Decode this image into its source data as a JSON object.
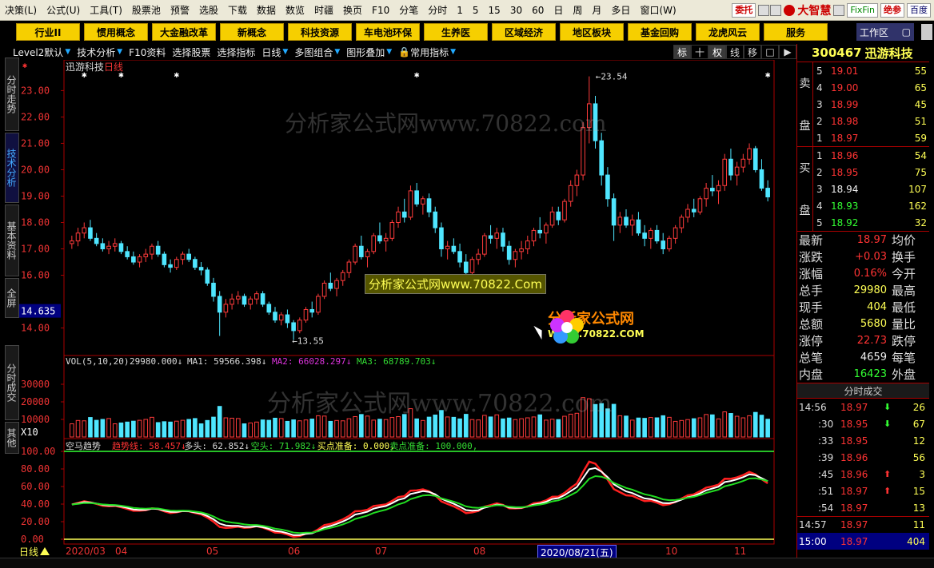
{
  "menu": {
    "items": [
      "决策(L)",
      "公式(U)",
      "工具(T)",
      "股票池",
      "预警",
      "选股",
      "下载",
      "数据",
      "数览",
      "时疆",
      "换页",
      "F10",
      "分笔",
      "分时",
      "1",
      "5",
      "15",
      "30",
      "60",
      "日",
      "周",
      "月",
      "多日",
      "窗口(W)"
    ],
    "badges": [
      "委托",
      "FixFin",
      "绝参",
      "百度"
    ],
    "brand": "大智慧"
  },
  "toolbar_buttons": [
    "行业II",
    "惯用概念",
    "大金融改革",
    "新概念",
    "科技资源",
    "车电池环保",
    "生养医",
    "区域经济",
    "地区板块",
    "基金回购",
    "龙虎风云",
    "服务"
  ],
  "workarea_label": "工作区",
  "left_tabs": [
    "分时走势",
    "技术分析",
    "基本资料",
    "全屏",
    "分时成交",
    "其他"
  ],
  "tool_row": {
    "items": [
      "Level2默认",
      "技术分析",
      "F10资料",
      "选择股票",
      "选择指标",
      "日线",
      "多图组合",
      "图形叠加",
      "常用指标"
    ],
    "toggles": [
      "标",
      "十",
      "权",
      "线",
      "移",
      "□",
      "▶"
    ]
  },
  "stock": {
    "code": "300467",
    "name": "迅游科技"
  },
  "chart": {
    "title": "迅游科技",
    "period_tag": "日线",
    "cursor_value": "14.635",
    "high_label": "23.54",
    "low_label": "13.55",
    "y_ticks": [
      "23.00",
      "22.00",
      "21.00",
      "20.00",
      "19.00",
      "18.00",
      "17.00",
      "16.00",
      "14.00"
    ],
    "vol_label": "VOL(5,10,20)",
    "vol_values": [
      {
        "name": "",
        "text": "29980.000↓",
        "color": "#dddddd"
      },
      {
        "name": "MA1:",
        "text": "59566.398↓",
        "color": "#dddddd"
      },
      {
        "name": "MA2:",
        "text": "66028.297↓",
        "color": "#dd33dd"
      },
      {
        "name": "MA3:",
        "text": "68789.703↓",
        "color": "#33dd33"
      }
    ],
    "vol_ticks": [
      "30000",
      "20000",
      "10000"
    ],
    "vol_unit": "X10",
    "ind_label": "空马趋势",
    "ind_values": [
      {
        "text": "趋势线: 58.457↓",
        "color": "#ff3333"
      },
      {
        "text": "多头: 62.852↓",
        "color": "#dddddd"
      },
      {
        "text": "空头: 71.982↓",
        "color": "#33dd33"
      },
      {
        "text": "买点准备: 0.000,",
        "color": "#ffff55"
      },
      {
        "text": "卖点准备: 100.000,",
        "color": "#33dd33"
      }
    ],
    "ind_ticks": [
      "100.00",
      "80.00",
      "60.00",
      "40.00",
      "20.00",
      "0.00"
    ],
    "months": [
      "2020/03",
      "04",
      "05",
      "06",
      "07",
      "08",
      "10",
      "11"
    ],
    "date_box": "2020/08/21(五)",
    "bottom_period": "日线"
  },
  "watermark": {
    "text1": "分析家公式网www.70822.com",
    "text2": "分析家公式网www.70822.com",
    "boxed": "分析家公式网www.70822.Com",
    "logo_a": "分析家公式网",
    "logo_b": "WWW.70822.COM"
  },
  "chart_data": {
    "type": "candlestick",
    "title": "迅游科技",
    "ylim": [
      13.2,
      23.8
    ],
    "candles": [
      [
        17.2,
        17.5,
        17.0,
        17.3
      ],
      [
        17.3,
        17.8,
        17.1,
        17.6
      ],
      [
        17.6,
        18.0,
        17.4,
        17.8
      ],
      [
        17.8,
        18.1,
        17.3,
        17.4
      ],
      [
        17.4,
        17.6,
        17.1,
        17.2
      ],
      [
        17.2,
        17.4,
        16.9,
        17.0
      ],
      [
        17.0,
        17.3,
        16.8,
        17.1
      ],
      [
        17.1,
        17.4,
        16.9,
        17.2
      ],
      [
        17.2,
        17.3,
        16.8,
        16.9
      ],
      [
        16.9,
        17.1,
        16.6,
        16.7
      ],
      [
        16.7,
        16.9,
        16.4,
        16.5
      ],
      [
        16.5,
        16.8,
        16.3,
        16.7
      ],
      [
        16.7,
        17.0,
        16.5,
        16.8
      ],
      [
        16.8,
        17.2,
        16.6,
        17.1
      ],
      [
        17.1,
        17.3,
        16.7,
        16.8
      ],
      [
        16.8,
        16.9,
        16.3,
        16.4
      ],
      [
        16.4,
        16.6,
        16.1,
        16.3
      ],
      [
        16.3,
        16.7,
        16.2,
        16.6
      ],
      [
        16.6,
        16.9,
        16.4,
        16.8
      ],
      [
        16.8,
        17.0,
        16.5,
        16.6
      ],
      [
        16.6,
        16.7,
        16.2,
        16.3
      ],
      [
        16.3,
        16.5,
        16.0,
        16.2
      ],
      [
        16.2,
        16.3,
        15.6,
        15.7
      ],
      [
        15.7,
        15.9,
        15.0,
        15.2
      ],
      [
        15.2,
        15.4,
        13.7,
        14.6
      ],
      [
        14.6,
        15.1,
        14.4,
        14.9
      ],
      [
        14.9,
        15.3,
        14.7,
        15.1
      ],
      [
        15.1,
        15.4,
        14.9,
        15.2
      ],
      [
        15.2,
        15.3,
        14.8,
        14.9
      ],
      [
        14.9,
        15.2,
        14.7,
        15.1
      ],
      [
        15.1,
        15.4,
        14.9,
        15.3
      ],
      [
        15.3,
        15.4,
        14.8,
        14.9
      ],
      [
        14.9,
        15.0,
        14.5,
        14.6
      ],
      [
        14.6,
        14.8,
        14.2,
        14.3
      ],
      [
        14.3,
        14.6,
        14.1,
        14.5
      ],
      [
        14.5,
        14.7,
        14.0,
        14.2
      ],
      [
        14.2,
        14.3,
        13.55,
        13.9
      ],
      [
        13.9,
        14.4,
        13.8,
        14.3
      ],
      [
        14.3,
        14.8,
        14.2,
        14.7
      ],
      [
        14.7,
        15.0,
        14.4,
        14.6
      ],
      [
        14.6,
        15.3,
        14.5,
        15.2
      ],
      [
        15.2,
        15.8,
        15.1,
        15.7
      ],
      [
        15.7,
        16.1,
        15.4,
        15.5
      ],
      [
        15.5,
        15.9,
        15.2,
        15.8
      ],
      [
        15.8,
        16.2,
        15.6,
        16.1
      ],
      [
        16.1,
        16.6,
        15.9,
        16.5
      ],
      [
        16.5,
        17.2,
        16.4,
        17.1
      ],
      [
        17.1,
        17.5,
        16.6,
        16.7
      ],
      [
        16.7,
        17.0,
        16.3,
        16.9
      ],
      [
        16.9,
        17.6,
        16.8,
        17.5
      ],
      [
        17.5,
        18.0,
        17.2,
        17.3
      ],
      [
        17.3,
        17.6,
        16.9,
        17.4
      ],
      [
        17.4,
        18.1,
        17.3,
        18.0
      ],
      [
        18.0,
        18.6,
        17.8,
        18.4
      ],
      [
        18.4,
        18.9,
        18.0,
        18.2
      ],
      [
        18.2,
        19.4,
        18.1,
        19.2
      ],
      [
        19.2,
        19.5,
        18.6,
        18.7
      ],
      [
        18.7,
        19.0,
        18.3,
        18.9
      ],
      [
        18.9,
        19.1,
        18.2,
        18.4
      ],
      [
        18.4,
        18.6,
        17.6,
        17.8
      ],
      [
        17.8,
        18.0,
        16.7,
        17.0
      ],
      [
        17.0,
        17.3,
        16.6,
        17.1
      ],
      [
        17.1,
        17.4,
        16.8,
        16.9
      ],
      [
        16.9,
        17.2,
        16.3,
        16.5
      ],
      [
        16.5,
        16.8,
        15.6,
        16.1
      ],
      [
        16.1,
        16.7,
        16.0,
        16.6
      ],
      [
        16.6,
        17.0,
        16.4,
        16.8
      ],
      [
        16.8,
        17.6,
        16.7,
        17.5
      ],
      [
        17.5,
        17.9,
        17.2,
        17.4
      ],
      [
        17.4,
        17.8,
        17.0,
        17.6
      ],
      [
        17.6,
        17.8,
        16.9,
        17.1
      ],
      [
        17.1,
        17.3,
        16.4,
        16.6
      ],
      [
        16.6,
        17.0,
        16.3,
        16.9
      ],
      [
        16.9,
        17.3,
        16.6,
        17.0
      ],
      [
        17.0,
        17.5,
        16.8,
        17.3
      ],
      [
        17.3,
        17.8,
        17.1,
        17.7
      ],
      [
        17.7,
        18.2,
        17.4,
        17.6
      ],
      [
        17.6,
        18.0,
        17.2,
        17.9
      ],
      [
        17.9,
        18.6,
        17.8,
        18.4
      ],
      [
        18.4,
        18.6,
        17.9,
        18.1
      ],
      [
        18.1,
        18.9,
        18.0,
        18.8
      ],
      [
        18.8,
        19.6,
        18.6,
        19.4
      ],
      [
        19.4,
        20.0,
        19.0,
        19.8
      ],
      [
        19.8,
        21.8,
        19.6,
        21.6
      ],
      [
        21.6,
        23.54,
        21.0,
        22.5
      ],
      [
        22.5,
        22.8,
        20.8,
        21.1
      ],
      [
        21.1,
        21.4,
        19.4,
        19.8
      ],
      [
        19.8,
        20.1,
        18.6,
        18.9
      ],
      [
        18.9,
        19.1,
        17.3,
        17.9
      ],
      [
        17.9,
        18.4,
        17.6,
        18.2
      ],
      [
        18.2,
        18.5,
        17.8,
        17.9
      ],
      [
        17.9,
        18.3,
        17.5,
        18.1
      ],
      [
        18.1,
        18.4,
        17.5,
        17.6
      ],
      [
        17.6,
        17.9,
        17.1,
        17.4
      ],
      [
        17.4,
        17.8,
        17.0,
        17.7
      ],
      [
        17.7,
        17.9,
        17.2,
        17.3
      ],
      [
        17.3,
        17.6,
        16.8,
        17.0
      ],
      [
        17.0,
        17.5,
        16.9,
        17.4
      ],
      [
        17.4,
        17.9,
        17.2,
        17.8
      ],
      [
        17.8,
        18.3,
        17.6,
        18.2
      ],
      [
        18.2,
        18.7,
        18.0,
        18.5
      ],
      [
        18.5,
        18.9,
        18.2,
        18.4
      ],
      [
        18.4,
        19.0,
        18.3,
        18.9
      ],
      [
        18.9,
        19.5,
        18.6,
        19.3
      ],
      [
        19.3,
        19.8,
        19.0,
        19.2
      ],
      [
        19.2,
        19.6,
        18.7,
        19.4
      ],
      [
        19.4,
        20.6,
        19.2,
        20.4
      ],
      [
        20.4,
        20.8,
        19.6,
        19.8
      ],
      [
        19.8,
        20.3,
        19.4,
        20.1
      ],
      [
        20.1,
        20.6,
        19.9,
        20.4
      ],
      [
        20.4,
        21.0,
        20.2,
        20.8
      ],
      [
        20.8,
        20.9,
        19.9,
        20.0
      ],
      [
        20.0,
        20.4,
        19.2,
        19.3
      ],
      [
        19.3,
        19.6,
        18.8,
        18.97
      ]
    ],
    "markers_x_index": [
      2,
      8,
      17,
      56,
      113
    ]
  }
}
